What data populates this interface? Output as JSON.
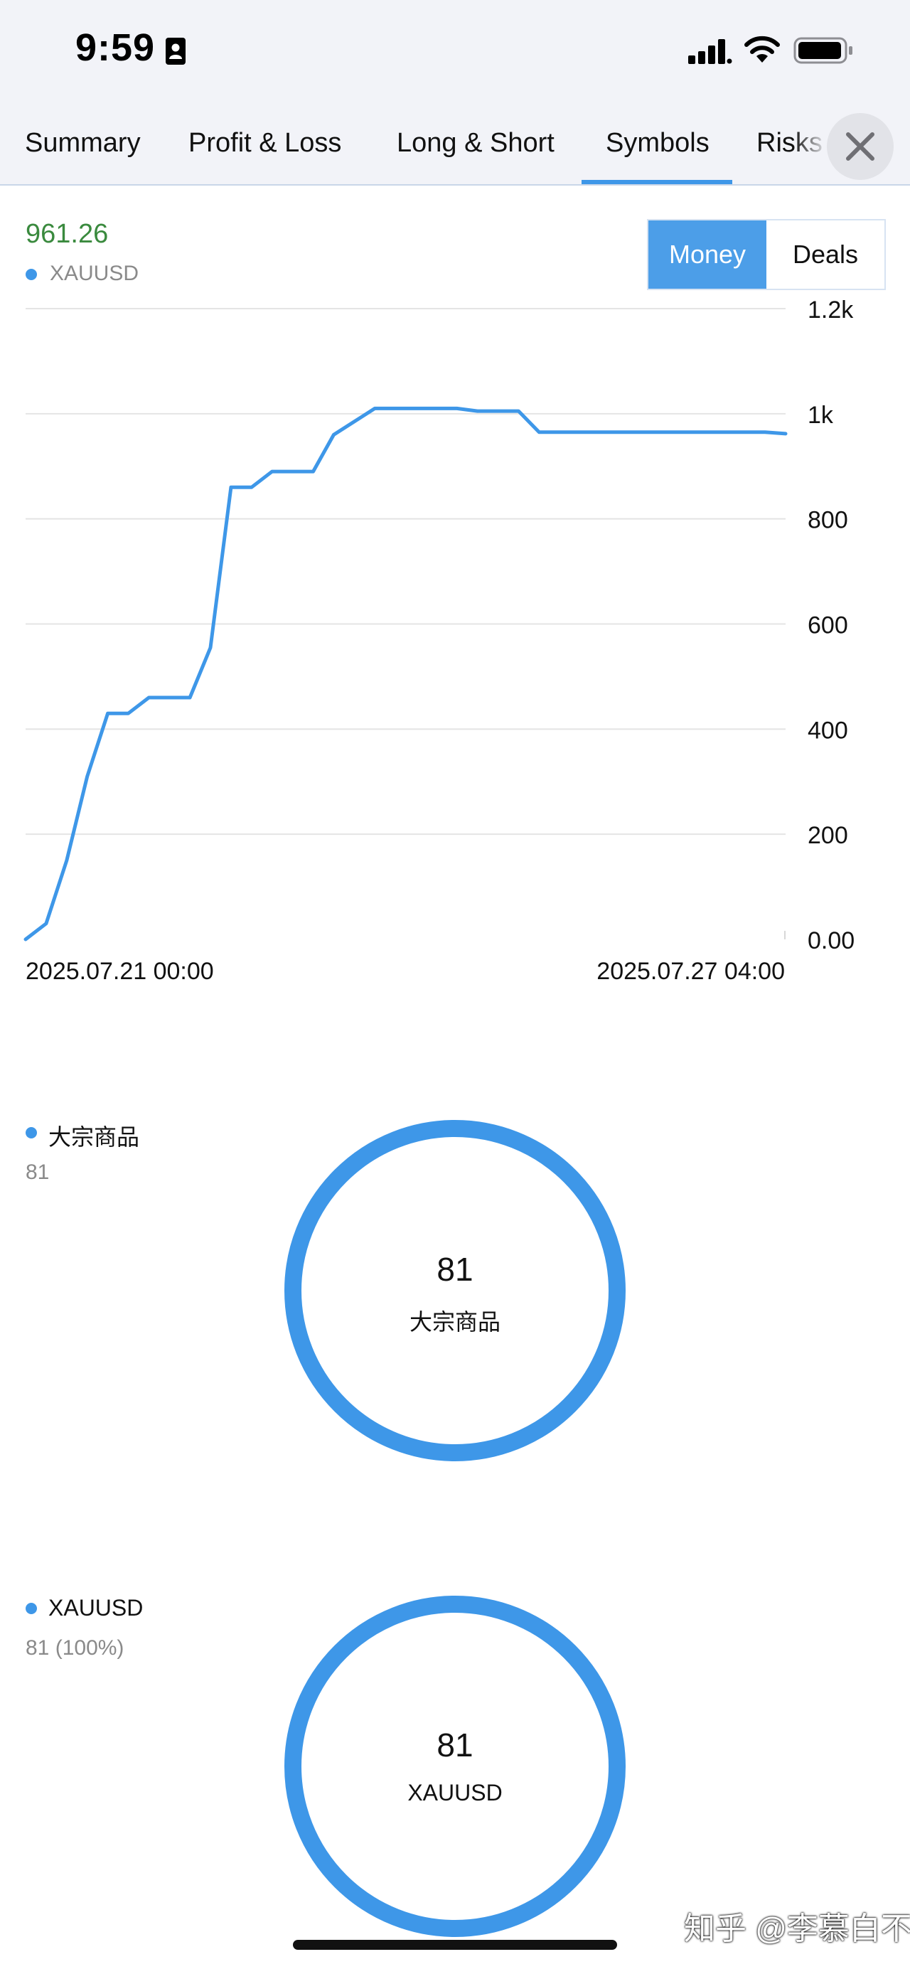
{
  "status": {
    "time": "9:59"
  },
  "tabs": [
    {
      "label": "Summary"
    },
    {
      "label": "Profit & Loss"
    },
    {
      "label": "Long & Short"
    },
    {
      "label": "Symbols",
      "active": true
    },
    {
      "label": "Risks"
    }
  ],
  "header": {
    "value": "961.26",
    "symbol": "XAUUSD",
    "toggle": {
      "money_label": "Money",
      "deals_label": "Deals",
      "selected": "Money"
    }
  },
  "chart_data": {
    "type": "line",
    "y_tick_labels": [
      "1.2k",
      "1k",
      "800",
      "600",
      "400",
      "200",
      "0.00"
    ],
    "x_tick_labels": [
      "2025.07.21 00:00",
      "2025.07.27 04:00"
    ],
    "ylim": [
      0,
      1200
    ],
    "grid": true,
    "series": [
      {
        "name": "XAUUSD",
        "color": "#3e97e8",
        "values": [
          0,
          30,
          150,
          310,
          430,
          430,
          460,
          460,
          460,
          555,
          860,
          860,
          890,
          890,
          890,
          960,
          985,
          1010,
          1010,
          1010,
          1010,
          1010,
          1005,
          1005,
          1005,
          965,
          965,
          965,
          965,
          965,
          965,
          965,
          965,
          965,
          965,
          965,
          965,
          962
        ]
      }
    ]
  },
  "categories": {
    "legend_label": "大宗商品",
    "legend_sub": "81",
    "ring_value": "81",
    "ring_label": "大宗商品",
    "ring_fraction": 1.0,
    "color": "#3e97e8"
  },
  "symbols": {
    "legend_label": "XAUUSD",
    "legend_sub": "81 (100%)",
    "ring_value": "81",
    "ring_label": "XAUUSD",
    "ring_fraction": 1.0,
    "color": "#3e97e8"
  },
  "watermark": "知乎 @李慕白不白"
}
